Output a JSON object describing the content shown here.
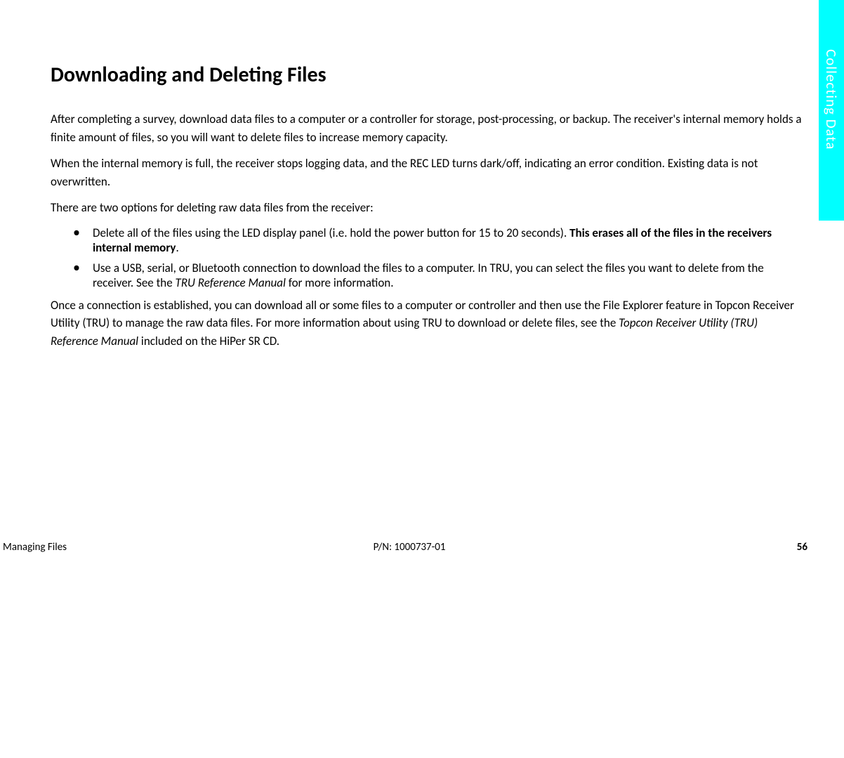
{
  "side_tab": {
    "label": "Collecting Data"
  },
  "main": {
    "heading": "Downloading and Deleting Files",
    "para1": "After completing a survey, download data files to a computer or a controller for storage, post-processing, or backup. The receiver's internal memory holds a finite amount of files, so you will want to delete files to increase memory capacity.",
    "para2": "When the internal memory is full, the receiver stops logging data, and the REC LED turns dark/off, indicating an error condition. Existing data is not overwritten.",
    "para3": "There are two options for deleting raw data files from the receiver:",
    "bullet1_a": "Delete all of the files using the LED display panel (i.e. hold the power button for 15 to 20 seconds). ",
    "bullet1_b": "This erases all of the files in the receivers internal memory",
    "bullet1_c": ".",
    "bullet2_a": "Use a USB, serial, or Bluetooth connection to download the files to a computer. In TRU, you can select the files you want to delete from the receiver. See the ",
    "bullet2_b": "TRU Reference Manual",
    "bullet2_c": " for more information.",
    "para4_a": "Once a connection is established, you can download all or some files to a computer or controller and then use the File Explorer feature in Topcon Receiver Utility (TRU) to manage the raw data files. For more information about using TRU to download or delete files, see the ",
    "para4_b": "Topcon Receiver Utility (TRU) Reference Manual",
    "para4_c": " included on the HiPer SR CD."
  },
  "footer": {
    "left": "Managing Files",
    "center": "P/N: 1000737-01",
    "right": "56"
  }
}
